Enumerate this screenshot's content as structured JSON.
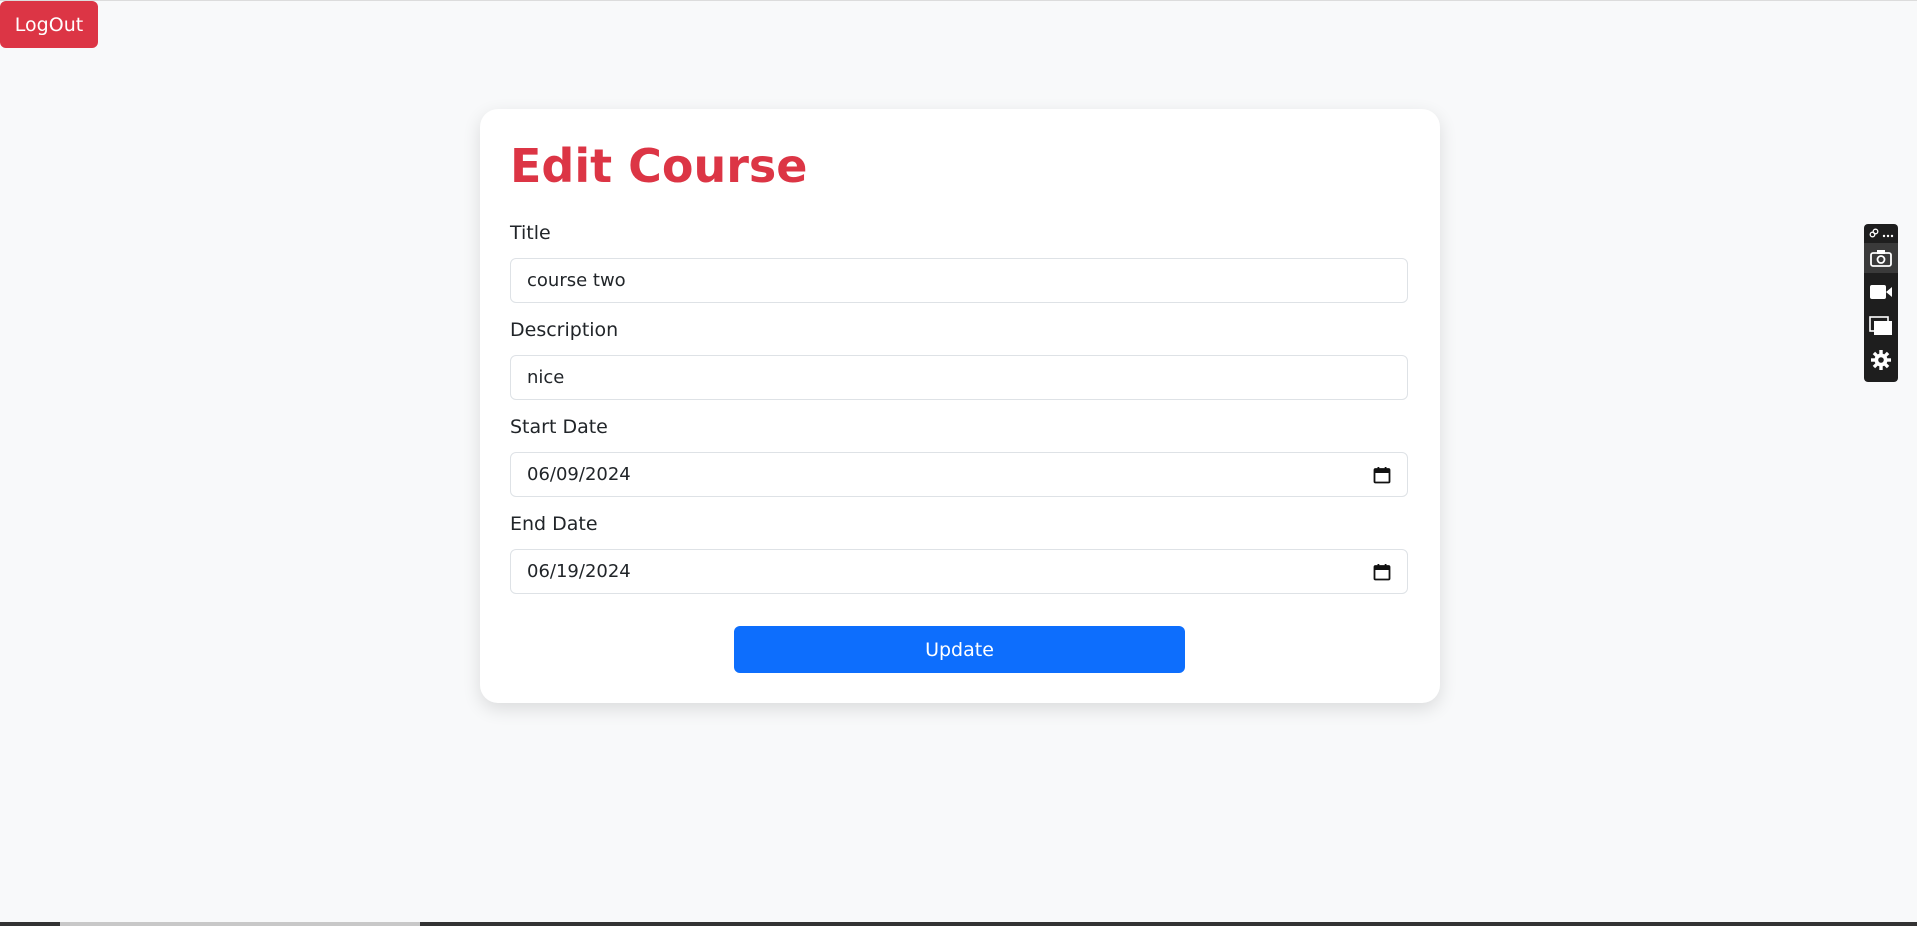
{
  "header": {
    "logout_label": "LogOut"
  },
  "form": {
    "title": "Edit Course",
    "fields": {
      "title": {
        "label": "Title",
        "value": "course two"
      },
      "description": {
        "label": "Description",
        "value": "nice"
      },
      "start_date": {
        "label": "Start Date",
        "value": "06/09/2024"
      },
      "end_date": {
        "label": "End Date",
        "value": "06/19/2024"
      }
    },
    "submit_label": "Update"
  },
  "toolbar": {
    "icons": [
      "link-icon",
      "more-icon",
      "camera-icon",
      "video-icon",
      "window-icon",
      "gear-icon"
    ]
  },
  "colors": {
    "accent_red": "#dc3545",
    "primary_blue": "#0d6efd",
    "background": "#f8f9fa"
  }
}
